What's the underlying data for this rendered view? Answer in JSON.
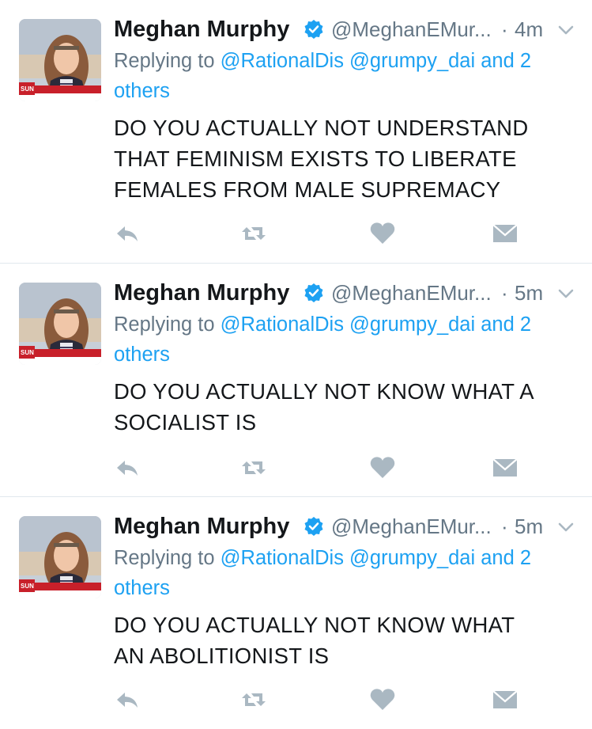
{
  "tweets": [
    {
      "author_name": "Meghan Murphy",
      "handle": "@MeghanEMur...",
      "separator": "·",
      "time": "4m",
      "replying_prefix": "Replying to ",
      "replying_users": "@RationalDis @grumpy_dai and 2",
      "replying_others": "others",
      "text_lines": [
        "DO YOU ACTUALLY NOT UNDERSTAND",
        "THAT FEMINISM EXISTS TO LIBERATE",
        "FEMALES FROM MALE SUPREMACY"
      ],
      "avatar_badge": "SUN NEWS"
    },
    {
      "author_name": "Meghan Murphy",
      "handle": "@MeghanEMur...",
      "separator": "·",
      "time": "5m",
      "replying_prefix": "Replying to ",
      "replying_users": "@RationalDis @grumpy_dai and 2",
      "replying_others": "others",
      "text_lines": [
        "DO YOU ACTUALLY NOT KNOW WHAT A",
        "SOCIALIST IS"
      ],
      "avatar_badge": "SUN NEWS"
    },
    {
      "author_name": "Meghan Murphy",
      "handle": "@MeghanEMur...",
      "separator": "·",
      "time": "5m",
      "replying_prefix": "Replying to ",
      "replying_users": "@RationalDis @grumpy_dai and 2",
      "replying_others": "others",
      "text_lines": [
        "DO YOU ACTUALLY NOT KNOW WHAT",
        "AN ABOLITIONIST IS"
      ],
      "avatar_badge": "SUN NEWS"
    }
  ],
  "icons": {
    "verified": "verified-badge-icon",
    "caret": "chevron-down-icon",
    "reply": "reply-icon",
    "retweet": "retweet-icon",
    "like": "heart-icon",
    "dm": "direct-message-icon"
  },
  "colors": {
    "name": "#14171a",
    "secondary": "#657786",
    "link": "#1da1f2",
    "action_icon": "#aab8c2",
    "divider": "#e1e8ed",
    "verified": "#1da1f2"
  }
}
